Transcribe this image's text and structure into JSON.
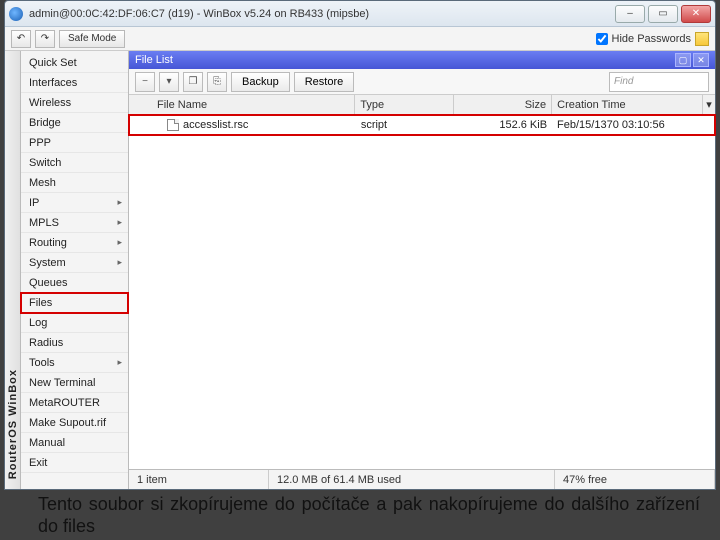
{
  "window": {
    "title": "admin@00:0C:42:DF:06:C7 (d19) - WinBox v5.24 on RB433 (mipsbe)"
  },
  "toprow": {
    "safe_mode": "Safe Mode",
    "hide_passwords": "Hide Passwords"
  },
  "vbar_text": "RouterOS WinBox",
  "sidebar": {
    "items": [
      {
        "label": "Quick Set",
        "arrow": false
      },
      {
        "label": "Interfaces",
        "arrow": false
      },
      {
        "label": "Wireless",
        "arrow": false
      },
      {
        "label": "Bridge",
        "arrow": false
      },
      {
        "label": "PPP",
        "arrow": false
      },
      {
        "label": "Switch",
        "arrow": false
      },
      {
        "label": "Mesh",
        "arrow": false
      },
      {
        "label": "IP",
        "arrow": true
      },
      {
        "label": "MPLS",
        "arrow": true
      },
      {
        "label": "Routing",
        "arrow": true
      },
      {
        "label": "System",
        "arrow": true
      },
      {
        "label": "Queues",
        "arrow": false
      },
      {
        "label": "Files",
        "arrow": false,
        "highlight": true
      },
      {
        "label": "Log",
        "arrow": false
      },
      {
        "label": "Radius",
        "arrow": false
      },
      {
        "label": "Tools",
        "arrow": true
      },
      {
        "label": "New Terminal",
        "arrow": false
      },
      {
        "label": "MetaROUTER",
        "arrow": false
      },
      {
        "label": "Make Supout.rif",
        "arrow": false
      },
      {
        "label": "Manual",
        "arrow": false
      },
      {
        "label": "Exit",
        "arrow": false
      }
    ]
  },
  "panel": {
    "title": "File List"
  },
  "filebar": {
    "backup": "Backup",
    "restore": "Restore",
    "find_placeholder": "Find"
  },
  "table": {
    "headers": {
      "name": "File Name",
      "type": "Type",
      "size": "Size",
      "time": "Creation Time"
    },
    "rows": [
      {
        "name": "accesslist.rsc",
        "type": "script",
        "size": "152.6 KiB",
        "time": "Feb/15/1370 03:10:56"
      }
    ]
  },
  "status": {
    "items": "1 item",
    "disk": "12.0 MB of 61.4 MB used",
    "free": "47% free"
  },
  "caption": "Tento soubor si zkopírujeme do počítače a pak nakopírujeme do dalšího zařízení do files"
}
